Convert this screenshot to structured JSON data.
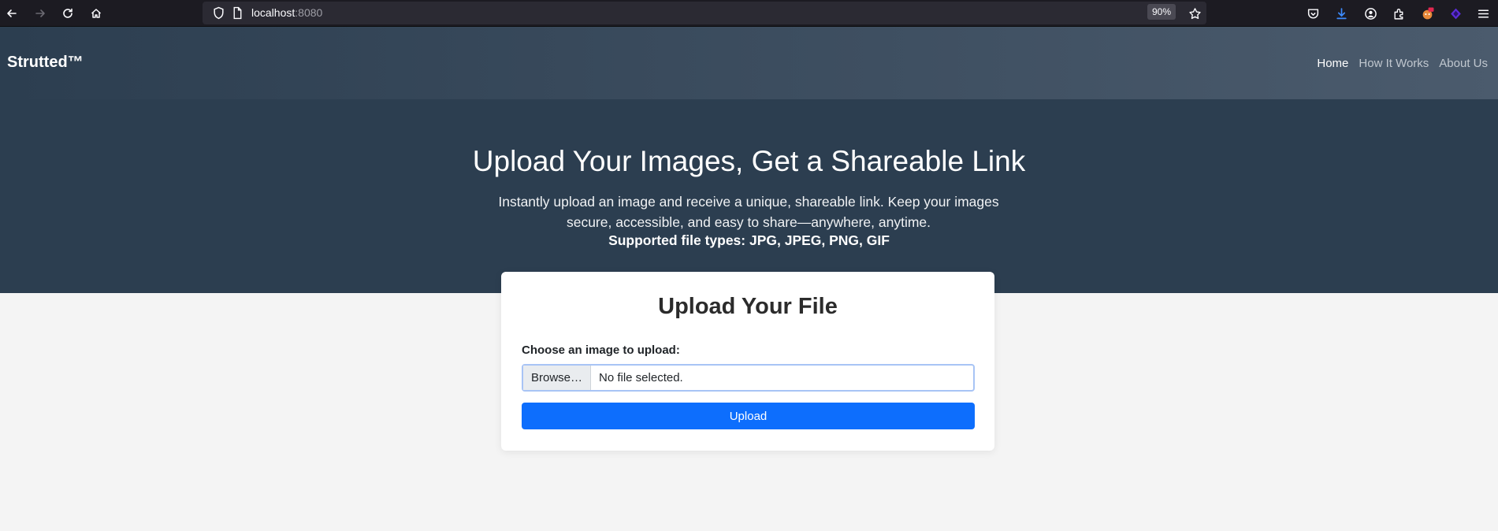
{
  "browser": {
    "url_host": "localhost",
    "url_port": ":8080",
    "zoom": "90%"
  },
  "navbar": {
    "brand": "Strutted™",
    "links": [
      "Home",
      "How It Works",
      "About Us"
    ]
  },
  "hero": {
    "title": "Upload Your Images, Get a Shareable Link",
    "description": "Instantly upload an image and receive a unique, shareable link. Keep your images secure, accessible, and easy to share—anywhere, anytime.",
    "supported": "Supported file types: JPG, JPEG, PNG, GIF"
  },
  "upload_card": {
    "title": "Upload Your File",
    "label": "Choose an image to upload:",
    "browse_label": "Browse…",
    "file_status": "No file selected.",
    "upload_label": "Upload"
  },
  "colors": {
    "hero_bg": "#2c3e50",
    "primary": "#0d6efd",
    "page_bg": "#f4f4f4"
  }
}
